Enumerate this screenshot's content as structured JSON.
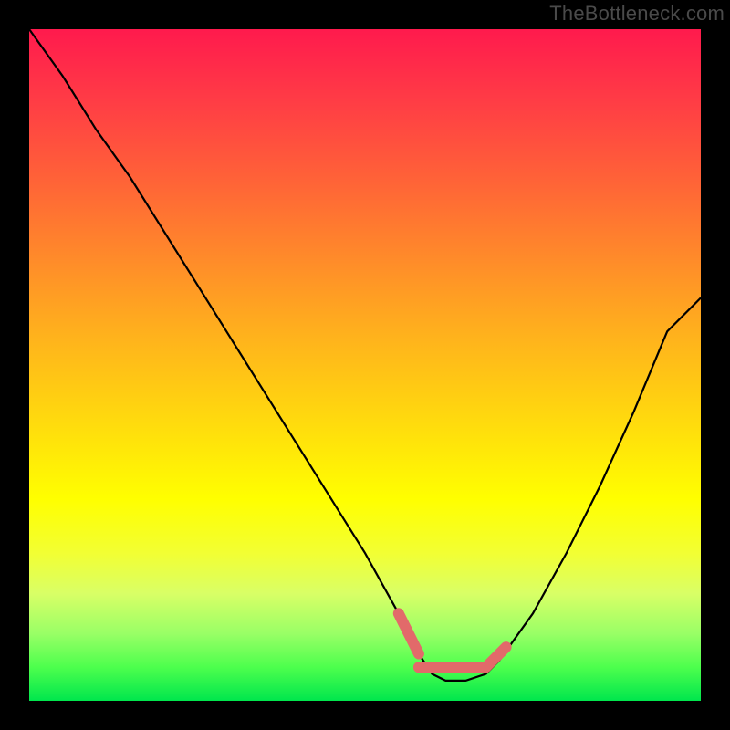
{
  "watermark": "TheBottleneck.com",
  "colors": {
    "frame": "#000000",
    "gradient_top": "#ff1a4d",
    "gradient_mid": "#ffff00",
    "gradient_bottom": "#00e64d",
    "curve": "#000000",
    "highlight": "#e26a6a"
  },
  "chart_data": {
    "type": "line",
    "title": "",
    "xlabel": "",
    "ylabel": "",
    "xlim": [
      0,
      100
    ],
    "ylim": [
      0,
      100
    ],
    "series": [
      {
        "name": "bottleneck-curve",
        "x": [
          0,
          5,
          10,
          15,
          20,
          25,
          30,
          35,
          40,
          45,
          50,
          55,
          58,
          60,
          62,
          65,
          68,
          70,
          75,
          80,
          85,
          90,
          95,
          100
        ],
        "y": [
          100,
          93,
          85,
          78,
          70,
          62,
          54,
          46,
          38,
          30,
          22,
          13,
          7,
          4,
          3,
          3,
          4,
          6,
          13,
          22,
          32,
          43,
          55,
          60
        ]
      }
    ],
    "highlight_segments": [
      {
        "x": [
          55,
          58
        ],
        "y": [
          13,
          7
        ]
      },
      {
        "x": [
          58,
          68
        ],
        "y": [
          5,
          5
        ]
      },
      {
        "x": [
          68,
          71
        ],
        "y": [
          5,
          8
        ]
      }
    ]
  }
}
